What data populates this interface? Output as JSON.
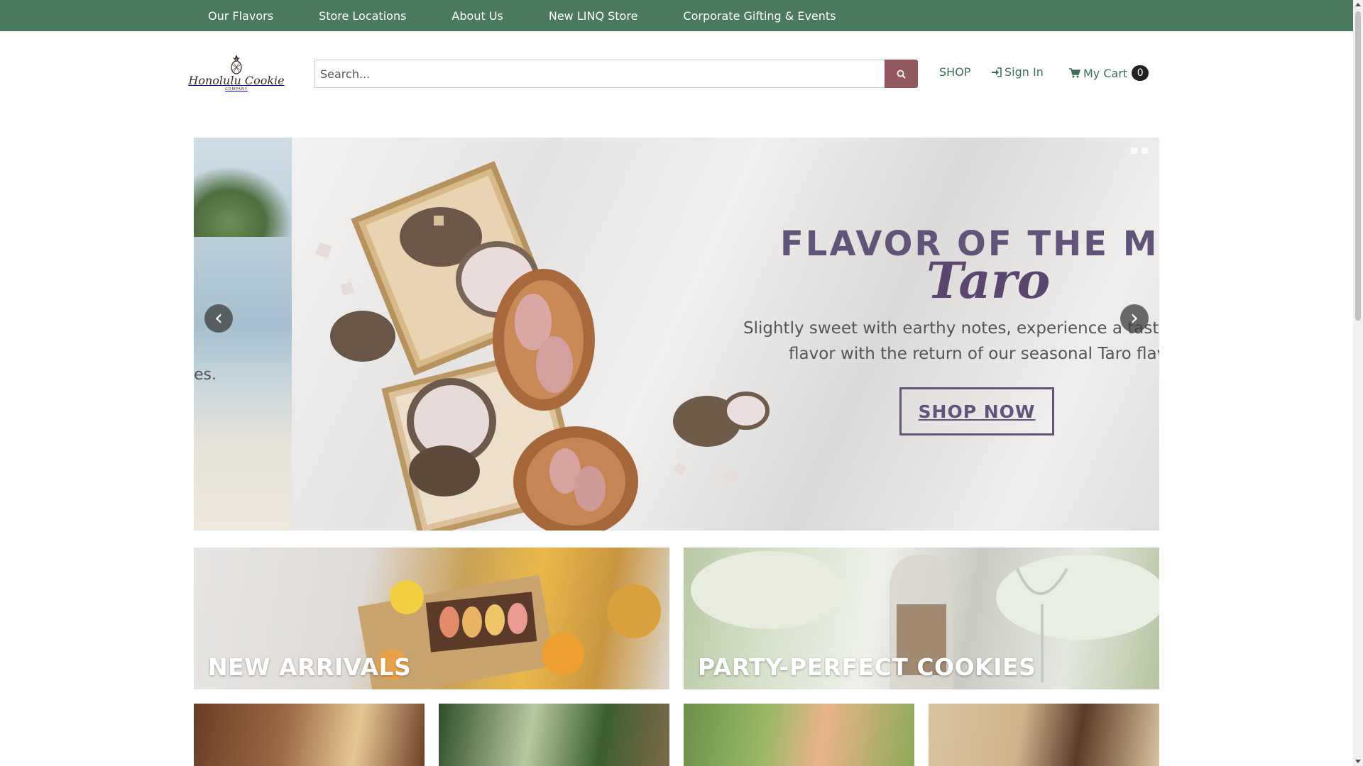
{
  "topnav": {
    "items": [
      {
        "label": "Our Flavors"
      },
      {
        "label": "Store Locations"
      },
      {
        "label": "About Us"
      },
      {
        "label": "New LINQ Store"
      },
      {
        "label": "Corporate Gifting & Events"
      }
    ]
  },
  "header": {
    "logo": {
      "name": "Honolulu Cookie",
      "sub": "COMPANY"
    },
    "search": {
      "placeholder": "Search..."
    },
    "shop_label": "SHOP",
    "signin_label": "Sign In",
    "cart_label": "My Cart",
    "cart_count": "0"
  },
  "hero": {
    "prev_slide_tail": "es.",
    "heading": "FLAVOR OF THE MONTH",
    "flavor": "Taro",
    "desc_line1": "Slightly sweet with earthy notes, experience a taste of",
    "desc_line2": "flavor with the return of our seasonal Taro flavor",
    "cta": "SHOP NOW",
    "prev_glyph": "‹",
    "next_glyph": "›"
  },
  "categories": [
    {
      "label": "NEW ARRIVALS"
    },
    {
      "label": "PARTY-PERFECT COOKIES"
    }
  ],
  "colors": {
    "nav_bg": "#4a7a5e",
    "link": "#3d6f55",
    "search_button": "#93585d",
    "hero_accent": "#62537a"
  }
}
